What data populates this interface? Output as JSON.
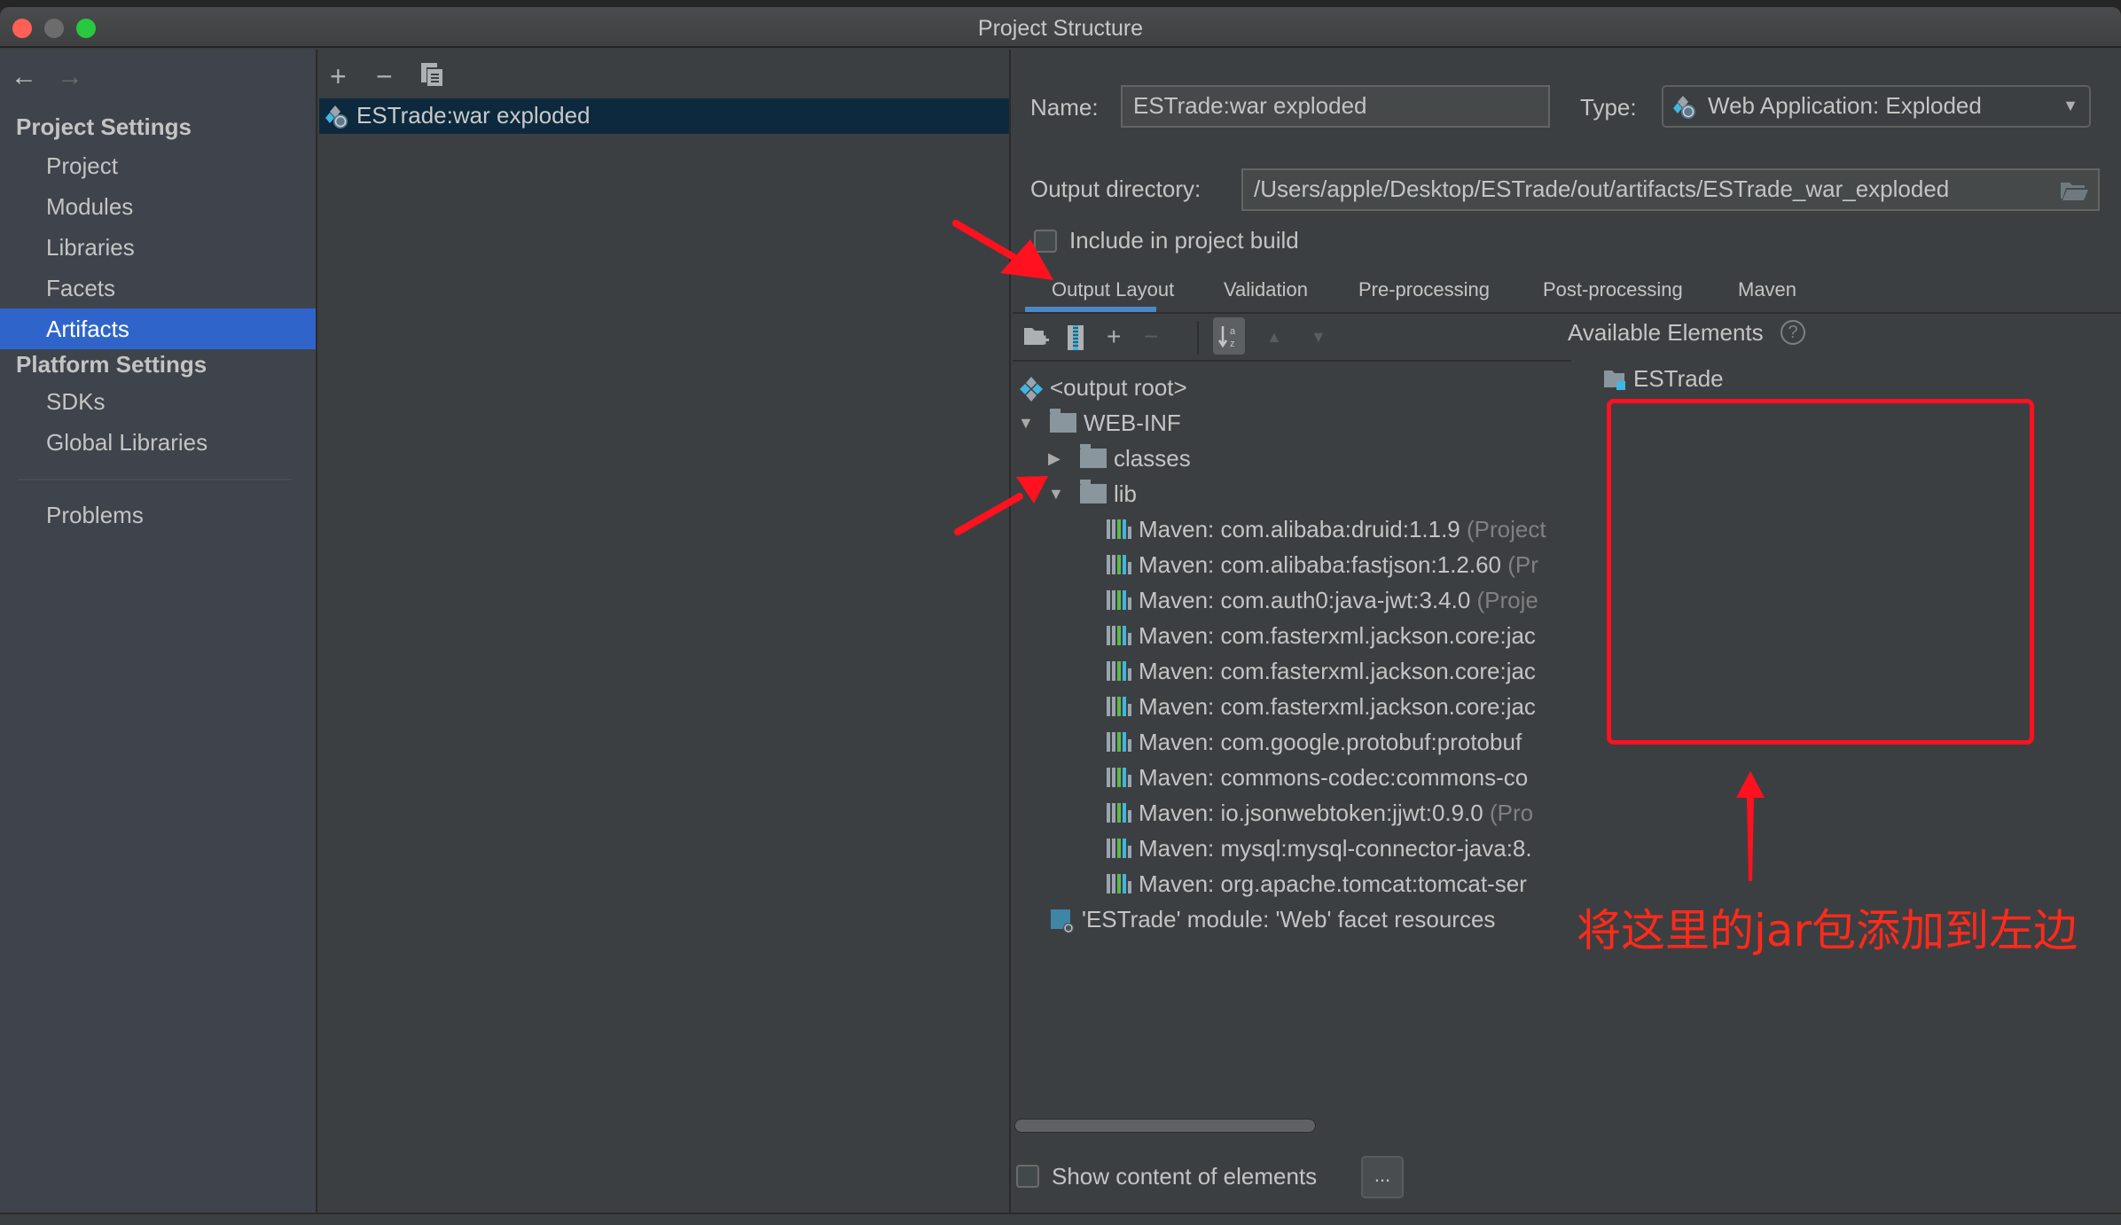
{
  "window": {
    "title": "Project Structure",
    "controls": {
      "close_color": "#fe5f57",
      "minimize_color": "#6c6c6c",
      "maximize_color": "#28c840"
    }
  },
  "sidebar": {
    "back_icon": "←",
    "forward_icon": "→",
    "sections": [
      {
        "header": "Project Settings",
        "items": [
          "Project",
          "Modules",
          "Libraries",
          "Facets",
          "Artifacts"
        ]
      },
      {
        "header": "Platform Settings",
        "items": [
          "SDKs",
          "Global Libraries"
        ]
      }
    ],
    "selected": "Artifacts",
    "problems": "Problems"
  },
  "artifacts_panel": {
    "toolbar": {
      "add": "+",
      "remove": "−",
      "copy": "⧉"
    },
    "items": [
      {
        "label": "ESTrade:war exploded",
        "selected": true
      }
    ]
  },
  "config": {
    "name_label": "Name:",
    "name_value": "ESTrade:war exploded",
    "type_label": "Type:",
    "type_value": "Web Application: Exploded",
    "output_dir_label": "Output directory:",
    "output_dir_value": "/Users/apple/Desktop/ESTrade/out/artifacts/ESTrade_war_exploded",
    "include_build_label": "Include in project build",
    "include_build_checked": false,
    "tabs": [
      "Output Layout",
      "Validation",
      "Pre-processing",
      "Post-processing",
      "Maven"
    ],
    "active_tab": "Output Layout",
    "layout_toolbar": {
      "add": "+",
      "remove": "−",
      "sort": "↓az",
      "up": "▲",
      "down": "▼"
    },
    "tree": {
      "root": "<output root>",
      "web_inf": "WEB-INF",
      "classes": "classes",
      "lib": "lib",
      "libs": [
        {
          "name": "Maven: com.alibaba:druid:1.1.9",
          "suffix": " (Project"
        },
        {
          "name": "Maven: com.alibaba:fastjson:1.2.60",
          "suffix": " (Pr"
        },
        {
          "name": "Maven: com.auth0:java-jwt:3.4.0",
          "suffix": " (Proje"
        },
        {
          "name": "Maven: com.fasterxml.jackson.core:jac",
          "suffix": ""
        },
        {
          "name": "Maven: com.fasterxml.jackson.core:jac",
          "suffix": ""
        },
        {
          "name": "Maven: com.fasterxml.jackson.core:jac",
          "suffix": ""
        },
        {
          "name": "Maven: com.google.protobuf:protobuf",
          "suffix": ""
        },
        {
          "name": "Maven: commons-codec:commons-co",
          "suffix": ""
        },
        {
          "name": "Maven: io.jsonwebtoken:jjwt:0.9.0",
          "suffix": " (Pro"
        },
        {
          "name": "Maven: mysql:mysql-connector-java:8.",
          "suffix": ""
        },
        {
          "name": "Maven: org.apache.tomcat:tomcat-ser",
          "suffix": ""
        }
      ],
      "facet_resources": "'ESTrade' module: 'Web' facet resources"
    },
    "available_elements_label": "Available Elements",
    "available_elements": [
      "ESTrade"
    ],
    "show_content_label": "Show content of elements",
    "show_content_checked": false,
    "more_button": "..."
  },
  "annotation": {
    "text": "将这里的jar包添加到左边",
    "color": "#ff1120"
  },
  "colors": {
    "selection": "#2f65ca",
    "tab_underline": "#4a88c7",
    "maven_green": "#5fb84a",
    "maven_blue": "#40b6e0"
  }
}
